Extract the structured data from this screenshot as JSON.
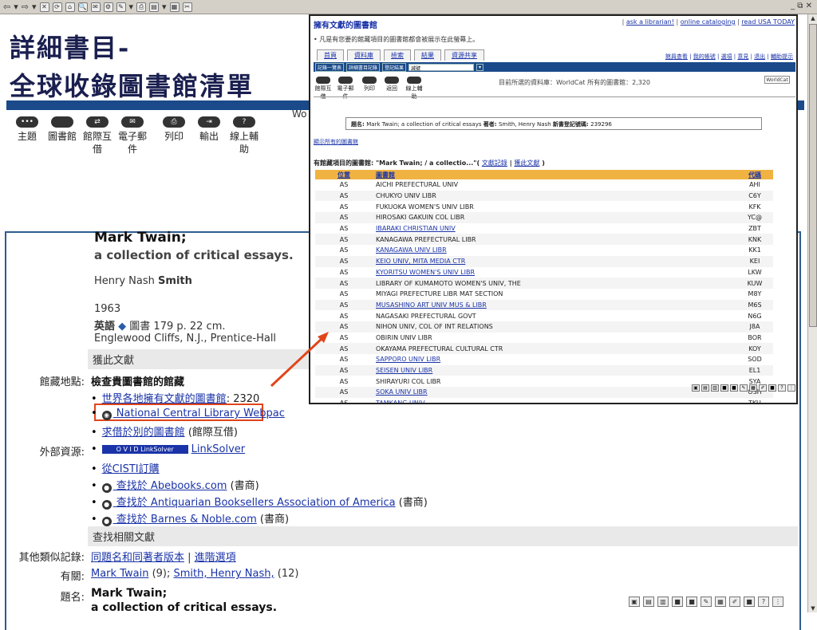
{
  "browser": {
    "toolbar_glyphs": [
      "⇦",
      "▾",
      "⇨",
      "▾",
      "✕",
      "⟳",
      "⌂",
      "🔍",
      "✉",
      "⚙",
      "✎",
      "▾",
      "⎙",
      "▤",
      "▾",
      "▦",
      "✂"
    ],
    "window_controls": "_ ⧉ ✕"
  },
  "title": {
    "line1": "詳細書目-",
    "line2": "全球收錄圖書館清單"
  },
  "toolbar": {
    "items": [
      {
        "label": "主題",
        "icon": "subject-icon"
      },
      {
        "label": "圖書館",
        "icon": "library-icon"
      },
      {
        "label": "館際互借",
        "icon": "interlibrary-loan-icon"
      },
      {
        "label": "電子郵件",
        "icon": "email-icon"
      },
      {
        "label": "列印",
        "icon": "print-icon"
      },
      {
        "label": "輸出",
        "icon": "export-icon"
      },
      {
        "label": "線上輔助",
        "icon": "help-icon"
      }
    ],
    "partial_text": "Wo"
  },
  "record": {
    "title": "Mark Twain;",
    "subtitle": "a collection of critical essays.",
    "author_first": "Henry Nash ",
    "author_last": "Smith",
    "year": "1963",
    "language": "英語",
    "format_desc": " 圖書 179 p. 22 cm.",
    "publisher": "Englewood Cliffs, N.J., Prentice-Hall",
    "get_section": "獲此文獻",
    "holdings_label": "館藏地點:",
    "holdings_title": "檢查貴圖書館的館藏",
    "libs_link": "世界各地擁有文獻的圖書館",
    "libs_count": ": 2320",
    "ncl_link": " National Central Library Webpac",
    "borrow_link": "求借於別的圖書館",
    "borrow_suffix": " (館際互借)",
    "external_label": "外部資源:",
    "linksolver_badge": "O V I D  LinkSolver",
    "linksolver": "LinkSolver",
    "cisti": "從CISTI訂購",
    "abebooks_link": " 查找於 Abebooks.com",
    "bookseller_suffix": " (書商)",
    "antiquarian_link": " 查找於 Antiquarian Booksellers Association of America",
    "bn_link": " 查找於 Barnes & Noble.com",
    "related_section": "查找相關文獻",
    "similar_label": "其他類似記錄:",
    "similar_link1": "同題名和同著者版本",
    "similar_sep": " | ",
    "similar_link2": "進階選項",
    "related_label": "有關:",
    "related_link1": "Mark Twain",
    "related_count1": " (9); ",
    "related_link2": "Smith, Henry Nash,",
    "related_count2": " (12)",
    "title_label": "題名:",
    "title_val1": "Mark Twain;",
    "title_val2": "a collection of critical essays."
  },
  "popup": {
    "heading": "擁有文獻的圖書館",
    "top_links": [
      "ask a librarian!",
      "online cataloging",
      "read USA TODAY"
    ],
    "note": "凡是有您要的館藏項目的圖書館都會被展示在此螢幕上。",
    "tabs": [
      "首頁",
      "資料庫",
      "檢索",
      "結果",
      "資源共享"
    ],
    "right_links": [
      "館員查看",
      "我的帳號",
      "選項",
      "意見",
      "退出",
      "輔助提示"
    ],
    "bar_buttons": [
      "記錄一覽表",
      "詳細書目記錄",
      "登記結果"
    ],
    "bar_select": "減號",
    "icons": [
      "館際互借",
      "電子郵件",
      "列印",
      "返回",
      "線上輔助"
    ],
    "db_text": "目前所選的資料庫：WorldCat 所有的圖書館：2,320",
    "logo": "WorldCat",
    "info_prefix": "題名: ",
    "info_title": "Mark Twain; a collection of critical essays ",
    "info_author_label": "著者: ",
    "info_author": "Smith, Henry Nash ",
    "info_num_label": "新書登記號碼: ",
    "info_num": "239296",
    "show_all": "顯示所有的圖書館",
    "hold_prefix": "有館藏項目的圖書館: \"Mark Twain; / a collectio...\"( ",
    "hold_link1": "文獻記錄",
    "hold_sep": " | ",
    "hold_link2": "獲此文獻",
    "hold_suffix": " )",
    "table_headers": [
      "位置",
      "圖書館",
      "代碼"
    ],
    "rows": [
      {
        "loc": "AS",
        "name": "AICHI PREFECTURAL UNIV",
        "code": "AHI",
        "link": false
      },
      {
        "loc": "AS",
        "name": "CHUKYO UNIV LIBR",
        "code": "C6Y",
        "link": false
      },
      {
        "loc": "AS",
        "name": "FUKUOKA WOMEN'S UNIV LIBR",
        "code": "KFK",
        "link": false
      },
      {
        "loc": "AS",
        "name": "HIROSAKI GAKUIN COL LIBR",
        "code": "YC@",
        "link": false
      },
      {
        "loc": "AS",
        "name": "IBARAKI CHRISTIAN UNIV",
        "code": "ZBT",
        "link": true
      },
      {
        "loc": "AS",
        "name": "KANAGAWA PREFECTURAL LIBR",
        "code": "KNK",
        "link": false
      },
      {
        "loc": "AS",
        "name": "KANAGAWA UNIV LIBR",
        "code": "KK1",
        "link": true
      },
      {
        "loc": "AS",
        "name": "KEIO UNIV, MITA MEDIA CTR",
        "code": "KEI",
        "link": true
      },
      {
        "loc": "AS",
        "name": "KYORITSU WOMEN'S UNIV LIBR",
        "code": "LKW",
        "link": true
      },
      {
        "loc": "AS",
        "name": "LIBRARY OF KUMAMOTO WOMEN'S UNIV, THE",
        "code": "KUW",
        "link": false
      },
      {
        "loc": "AS",
        "name": "MIYAGI PREFECTURE LIBR MAT SECTION",
        "code": "M8Y",
        "link": false
      },
      {
        "loc": "AS",
        "name": "MUSASHINO ART UNIV MUS & LIBR",
        "code": "M6S",
        "link": true
      },
      {
        "loc": "AS",
        "name": "NAGASAKI PREFECTURAL GOVT",
        "code": "N6G",
        "link": false
      },
      {
        "loc": "AS",
        "name": "NIHON UNIV, COL OF INT RELATIONS",
        "code": "J8A",
        "link": false
      },
      {
        "loc": "AS",
        "name": "OBIRIN UNIV LIBR",
        "code": "BOR",
        "link": false
      },
      {
        "loc": "AS",
        "name": "OKAYAMA PREFECTURAL CULTURAL CTR",
        "code": "KOY",
        "link": false
      },
      {
        "loc": "AS",
        "name": "SAPPORO UNIV LIBR",
        "code": "SOD",
        "link": true
      },
      {
        "loc": "AS",
        "name": "SEISEN UNIV LIBR",
        "code": "EL1",
        "link": true
      },
      {
        "loc": "AS",
        "name": "SHIRAYURI COL LIBR",
        "code": "SYA",
        "link": false
      },
      {
        "loc": "AS",
        "name": "SOKA UNIV LIBR",
        "code": "OSH",
        "link": true
      },
      {
        "loc": "AS",
        "name": "TAMKANG UNIV",
        "code": "TKU",
        "link": true
      }
    ]
  },
  "colors": {
    "accent_blue": "#1a4a8a",
    "link": "#1a33a8",
    "highlight": "#e0451a",
    "table_header": "#f0b341"
  }
}
